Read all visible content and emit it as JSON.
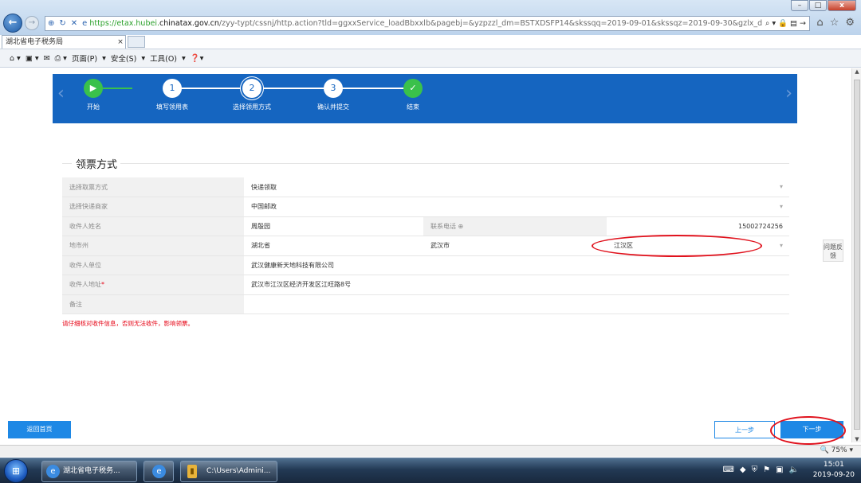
{
  "browser": {
    "url_prefix": "https://etax.hubei.",
    "url_domain": "chinatax.gov.cn",
    "url_rest": "/zyy-typt/cssnj/http.action?tld=ggxxService_loadBbxxlb&pagebj=&yzpzzl_dm=BSTXDSFP14&skssqq=2019-09-01&skssqz=2019-09-30&gzlx_dm",
    "tab_title": "湖北省电子税务局",
    "menu": [
      "页面(P)",
      "安全(S)",
      "工具(O)"
    ],
    "window_buttons": [
      "–",
      "□",
      "x"
    ]
  },
  "steps": [
    {
      "num": "▶",
      "label": "开始",
      "state": "done"
    },
    {
      "num": "1",
      "label": "填写领用表",
      "state": "todo"
    },
    {
      "num": "2",
      "label": "选择领用方式",
      "state": "current"
    },
    {
      "num": "3",
      "label": "确认并提交",
      "state": "todo"
    },
    {
      "num": "✓",
      "label": "结束",
      "state": "done"
    }
  ],
  "section_title": "领票方式",
  "form": {
    "method_label": "选择取票方式",
    "method_value": "快递领取",
    "courier_label": "选择快递商家",
    "courier_value": "中国邮政",
    "name_label": "收件人姓名",
    "name_value": "周殷园",
    "phone_label": "联系电话 ⊕",
    "phone_value": "15002724256",
    "region_label": "地市州",
    "province_value": "湖北省",
    "city_value": "武汉市",
    "district_value": "江汉区",
    "company_label": "收件人单位",
    "company_value": "武汉健康新天地科技有限公司",
    "address_label": "收件人地址",
    "address_required": "*",
    "address_value": "武汉市江汉区经济开发区江旺路8号",
    "remark_label": "备注",
    "remark_value": ""
  },
  "warning": "请仔细核对收件信息，否则无法收件，影响领票。",
  "feedback": "问题反馈",
  "buttons": {
    "home": "返回首页",
    "prev": "上一步",
    "next": "下一步"
  },
  "status": {
    "zoom": "75%"
  },
  "taskbar": {
    "ie_window": "湖北省电子税务...",
    "explorer_window": "C:\\Users\\Admini...",
    "time": "15:01",
    "date": "2019-09-20"
  },
  "colors": {
    "banner": "#1565c0",
    "done": "#3ac14b",
    "button": "#1e88e5",
    "annotation": "#e0121d"
  }
}
